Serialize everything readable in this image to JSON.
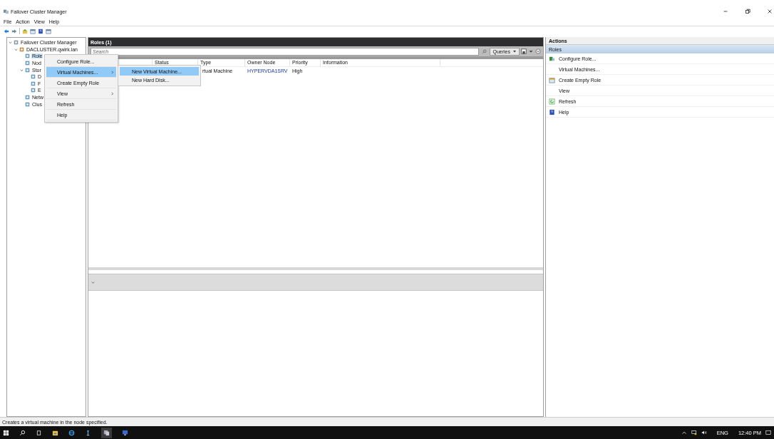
{
  "window": {
    "title": "Failover Cluster Manager"
  },
  "menu": [
    "File",
    "Action",
    "View",
    "Help"
  ],
  "tree": [
    {
      "label": "Failover Cluster Manager",
      "selected": false,
      "expanded": true,
      "children": [
        {
          "label": "DACLUSTER.qwirk.lan",
          "selected": false,
          "expanded": true,
          "children": [
            {
              "label": "Role",
              "selected": true
            },
            {
              "label": "Nod",
              "selected": false
            },
            {
              "label": "Stor",
              "selected": false,
              "expanded": true,
              "children": [
                {
                  "label": "D",
                  "selected": false
                },
                {
                  "label": "F",
                  "selected": false
                },
                {
                  "label": "E",
                  "selected": false
                }
              ]
            },
            {
              "label": "Netw",
              "selected": false
            },
            {
              "label": "Clus",
              "selected": false
            }
          ]
        }
      ]
    }
  ],
  "roles_pane": {
    "title": "Roles (1)",
    "search": {
      "placeholder": "Search"
    },
    "queries_button": "Queries",
    "columns": [
      "Status",
      "Type",
      "Owner Node",
      "Priority",
      "Information"
    ],
    "rows": [
      {
        "status": "",
        "type": "rtual Machine",
        "owner_node": "HYPERVDA1SRV",
        "priority": "High"
      }
    ]
  },
  "context_menu": [
    {
      "label": "Configure Role...",
      "submenu": false,
      "selected": false
    },
    {
      "label": "Virtual Machines...",
      "submenu": true,
      "selected": true
    },
    {
      "label": "Create Empty Role",
      "submenu": false,
      "selected": false
    },
    {
      "label": "View",
      "submenu": true,
      "selected": false
    },
    {
      "label": "Refresh",
      "submenu": false,
      "selected": false
    },
    {
      "label": "Help",
      "submenu": false,
      "selected": false
    }
  ],
  "submenu": [
    {
      "label": "New Virtual Machine...",
      "selected": true
    },
    {
      "label": "New Hard Disk...",
      "selected": false
    }
  ],
  "actions": {
    "title": "Actions",
    "section": "Roles",
    "items": [
      {
        "label": "Configure Role...",
        "kind": "configure"
      },
      {
        "label": "Virtual Machines...",
        "kind": "plain"
      },
      {
        "label": "Create Empty Role",
        "kind": "create"
      },
      {
        "label": "View",
        "kind": "plain"
      },
      {
        "label": "Refresh",
        "kind": "refresh"
      },
      {
        "label": "Help",
        "kind": "help"
      }
    ]
  },
  "status_bar": "Creates a virtual machine in the node specified.",
  "taskbar": {
    "language": "ENG",
    "time": "12:40 PM"
  }
}
